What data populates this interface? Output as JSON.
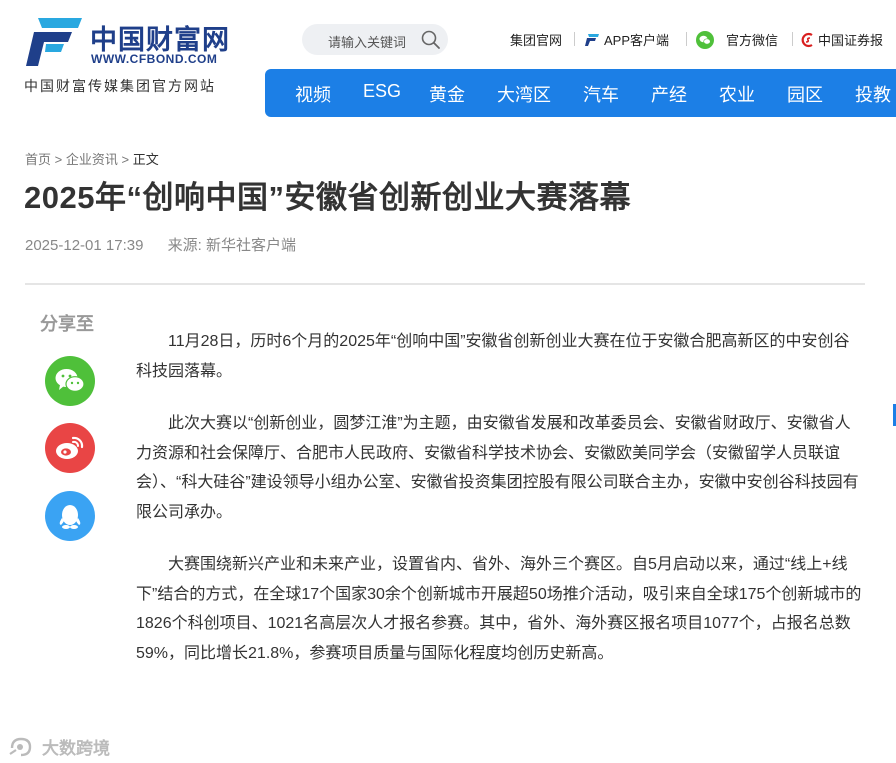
{
  "header": {
    "logo_cn": "中国财富网",
    "logo_url": "WWW.CFBOND.COM",
    "logo_subtitle": "中国财富传媒集团官方网站",
    "search_placeholder": "请输入关键词",
    "links": [
      {
        "label": "集团官网",
        "icon": ""
      },
      {
        "label": "APP客户端",
        "icon": "app-logo-icon"
      },
      {
        "label": "官方微信",
        "icon": "wechat-icon"
      },
      {
        "label": "中国证券报",
        "icon": "cs-logo-icon"
      }
    ]
  },
  "nav": {
    "items": [
      "视频",
      "ESG",
      "黄金",
      "大湾区",
      "汽车",
      "产经",
      "农业",
      "园区",
      "投教"
    ]
  },
  "breadcrumb": {
    "home": "首页",
    "section": "企业资讯",
    "current": "正文",
    "separator": ">"
  },
  "article": {
    "title": "2025年“创响中国”安徽省创新创业大赛落幕",
    "datetime": "2025-12-01 17:39",
    "source": "来源: 新华社客户端",
    "paragraphs": [
      "11月28日，历时6个月的2025年“创响中国”安徽省创新创业大赛在位于安徽合肥高新区的中安创谷科技园落幕。",
      "此次大赛以“创新创业，圆梦江淮”为主题，由安徽省发展和改革委员会、安徽省财政厅、安徽省人力资源和社会保障厅、合肥市人民政府、安徽省科学技术协会、安徽欧美同学会（安徽留学人员联谊会）、“科大硅谷”建设领导小组办公室、安徽省投资集团控股有限公司联合主办，安徽中安创谷科技园有限公司承办。",
      "大赛围绕新兴产业和未来产业，设置省内、省外、海外三个赛区。自5月启动以来，通过“线上+线下”结合的方式，在全球17个国家30余个创新城市开展超50场推介活动，吸引来自全球175个创新城市的1826个科创项目、1021名高层次人才报名参赛。其中，省外、海外赛区报名项目1077个，占报名总数59%，同比增长21.8%，参赛项目质量与国际化程度均创历史新高。"
    ]
  },
  "share": {
    "label": "分享至",
    "buttons": [
      "wechat-icon",
      "weibo-icon",
      "qq-icon"
    ]
  },
  "watermark": "大数跨境",
  "colors": {
    "nav_bg": "#1c7fe6",
    "brand_blue": "#1f3f8a",
    "wechat": "#4fc03a",
    "weibo": "#e94545",
    "qq": "#3aa3f3"
  }
}
